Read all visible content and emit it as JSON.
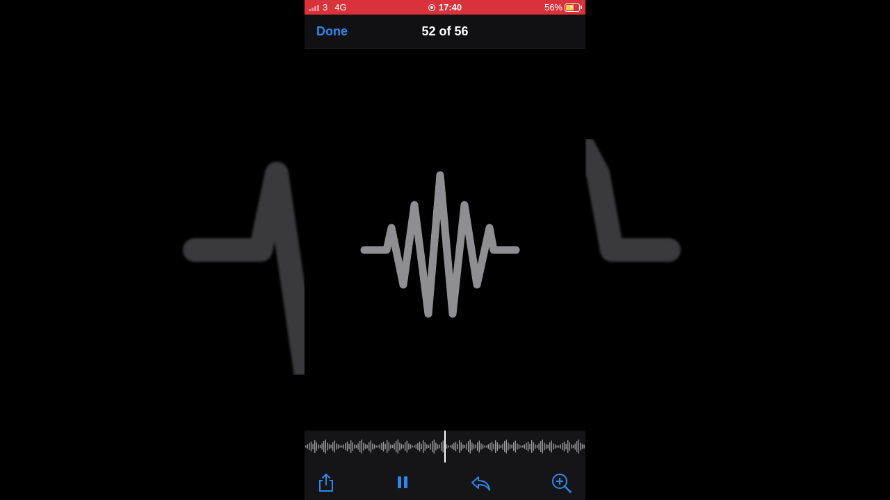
{
  "status_bar": {
    "carrier": "3",
    "network": "4G",
    "time": "17:40",
    "battery": "56%"
  },
  "nav": {
    "done_label": "Done",
    "title": "52 of 56"
  },
  "player": {
    "state": "playing",
    "icons": [
      "share-icon",
      "pause-icon",
      "reply-icon",
      "zoom-icon"
    ]
  },
  "colors": {
    "accent": "#2f86ec",
    "status_bar": "#d9323a",
    "waveform": "#8e8e93"
  }
}
